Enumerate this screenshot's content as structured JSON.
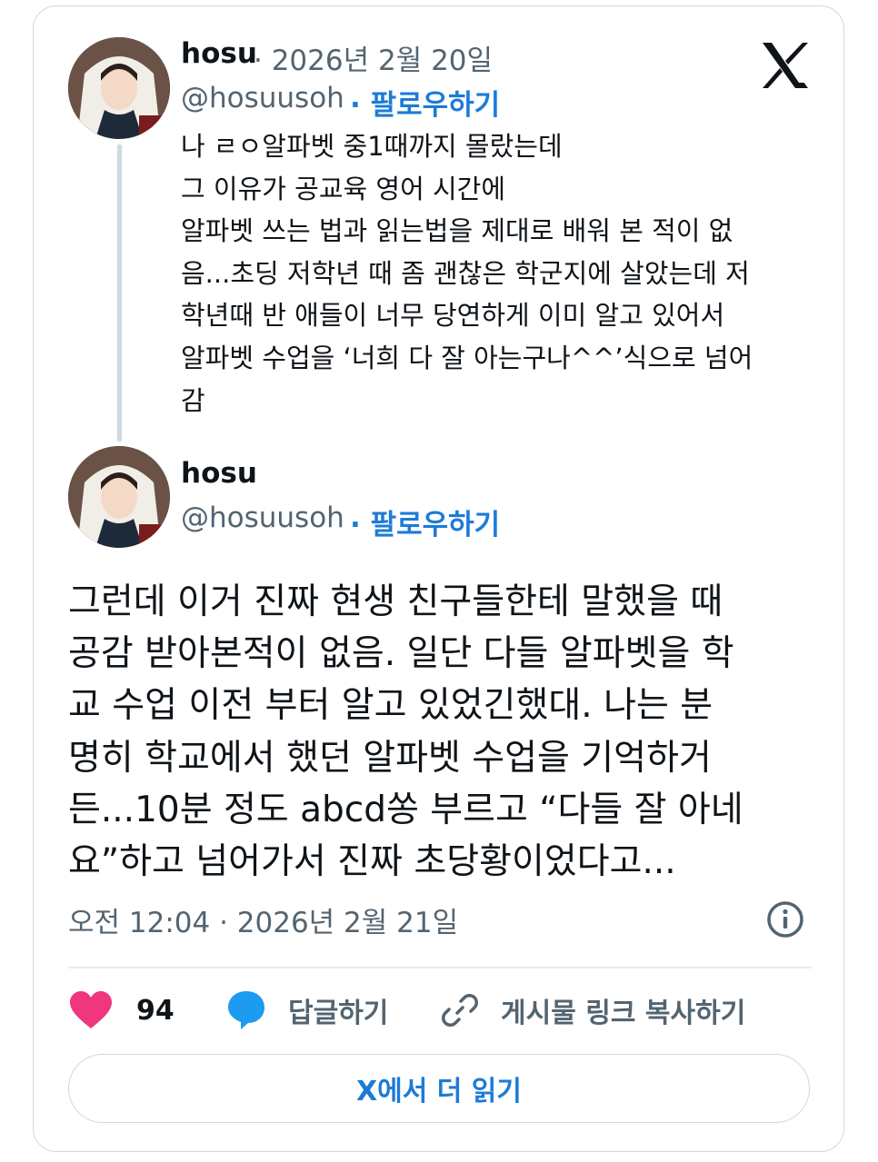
{
  "quoted_tweet": {
    "name": "hosu",
    "date": "· 2026년 2월 20일",
    "handle": "@hosuusoh",
    "follow": "· 팔로우하기",
    "lines": [
      "나 ㄹㅇ알파벳 중1때까지 몰랐는데",
      "그 이유가 공교육 영어 시간에",
      "알파벳 쓰는 법과 읽는법을 제대로 배워 본 적이 없",
      "음...초딩 저학년 때 좀 괜찮은 학군지에 살았는데 저",
      "학년때 반 애들이 너무 당연하게 이미 알고 있어서",
      "알파벳 수업을 ‘너희 다 잘 아는구나^^’식으로 넘어",
      "감"
    ]
  },
  "main_tweet": {
    "name": "hosu",
    "handle": "@hosuusoh",
    "follow": "· 팔로우하기",
    "lines": [
      "그런데 이거 진짜 현생 친구들한테 말했을 때",
      "공감 받아본적이 없음. 일단 다들 알파벳을 학",
      "교 수업 이전 부터 알고 있었긴했대. 나는 분",
      "명히 학교에서 했던 알파벳 수업을 기억하거",
      "든...10분 정도 abcd쏭 부르고 “다들 잘 아네",
      "요”하고 넘어가서 진짜 초당황이었다고..."
    ],
    "timestamp": "오전 12:04 · 2026년 2월 21일"
  },
  "actions": {
    "like_count": "94",
    "reply_label": "답글하기",
    "copy_link_label": "게시물 링크 복사하기"
  },
  "read_more": "X에서 더 읽기",
  "colors": {
    "like": "#f0367f",
    "reply": "#1d9bf0",
    "link_blue": "#1d7bd6",
    "muted": "#536471",
    "border": "#cfd9de"
  }
}
